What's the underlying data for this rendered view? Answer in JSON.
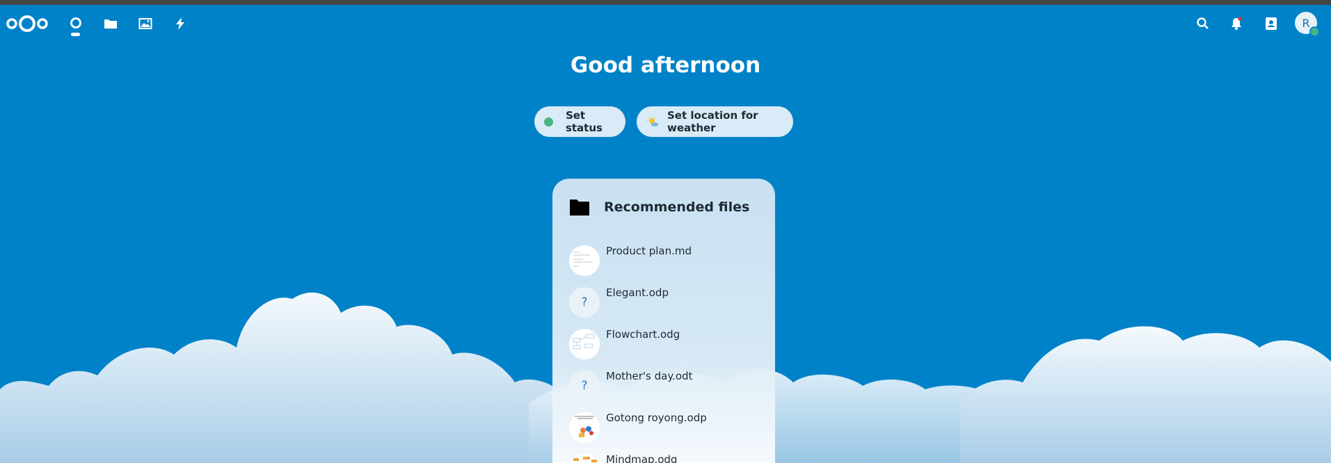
{
  "header": {
    "nav": [
      {
        "name": "dashboard",
        "icon": "dashboard-icon"
      },
      {
        "name": "files",
        "icon": "folder-icon"
      },
      {
        "name": "photos",
        "icon": "image-icon"
      },
      {
        "name": "activity",
        "icon": "lightning-icon"
      }
    ],
    "right_icons": [
      "search-icon",
      "notifications-icon",
      "contacts-icon"
    ],
    "avatar_initial": "R"
  },
  "dashboard": {
    "greeting": "Good afternoon",
    "set_status_label": "Set status",
    "set_weather_label": "Set location for weather"
  },
  "widget": {
    "title": "Recommended files",
    "items": [
      {
        "name": "Product plan.md",
        "thumb": "preview"
      },
      {
        "name": "Elegant.odp",
        "thumb": "?"
      },
      {
        "name": "Flowchart.odg",
        "thumb": "preview"
      },
      {
        "name": "Mother's day.odt",
        "thumb": "?"
      },
      {
        "name": "Gotong royong.odp",
        "thumb": "preview"
      },
      {
        "name": "Mindmap.odg",
        "thumb": "preview"
      }
    ]
  },
  "colors": {
    "primary": "#0082c9",
    "status_online": "#49b382",
    "text_dark": "#1e2a33"
  }
}
